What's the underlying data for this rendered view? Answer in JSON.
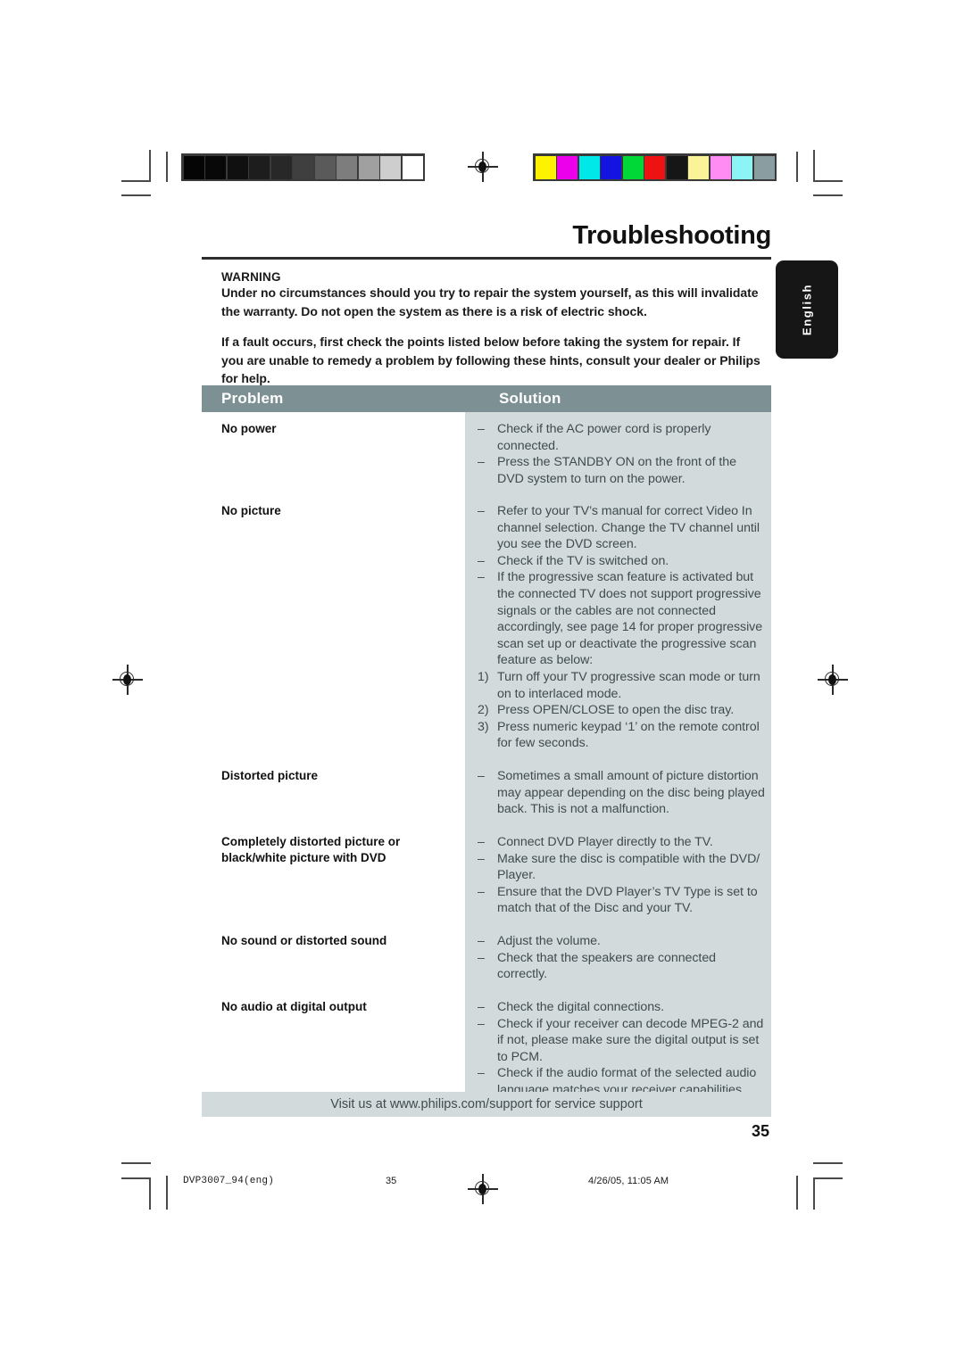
{
  "page": {
    "title": "Troubleshooting",
    "language_tab": "English",
    "page_number": "35"
  },
  "warning": {
    "heading": "WARNING",
    "paragraph1": "Under no circumstances should you try to repair the system yourself, as this will invalidate the warranty.  Do not open the system as there is a risk of electric shock.",
    "paragraph2": "If a fault occurs, first check the points listed below before taking the system for repair. If you are unable to remedy a problem by following these hints, consult your dealer or Philips for help."
  },
  "table": {
    "headers": {
      "problem": "Problem",
      "solution": "Solution"
    },
    "rows": [
      {
        "problem": "No power",
        "solutions": [
          {
            "marker": "–",
            "text": "Check if the AC power cord is properly connected."
          },
          {
            "marker": "–",
            "text": "Press the STANDBY ON on the front of the DVD system to turn on the power."
          }
        ]
      },
      {
        "problem": "No picture",
        "solutions": [
          {
            "marker": "–",
            "text": "Refer to your TV’s manual for correct Video In channel selection.  Change the TV channel until you see the DVD screen."
          },
          {
            "marker": "–",
            "text": "Check if the TV is switched on."
          },
          {
            "marker": "–",
            "text": "If the progressive scan feature is activated but the connected TV does not support progressive signals or the cables are not connected accordingly, see page 14 for proper progressive scan set up or deactivate the progressive scan feature as below:"
          },
          {
            "marker": "1)",
            "text": "Turn off your TV progressive scan mode or turn on to interlaced mode."
          },
          {
            "marker": "2)",
            "text": "Press OPEN/CLOSE to open the disc tray."
          },
          {
            "marker": "3)",
            "text": "Press numeric keypad ‘1’ on the remote control for few seconds."
          }
        ]
      },
      {
        "problem": "Distorted picture",
        "solutions": [
          {
            "marker": "–",
            "text": "Sometimes a small amount of picture distortion may appear depending on the disc being played back. This is not a malfunction."
          }
        ]
      },
      {
        "problem": "Completely distorted picture or black/white picture with DVD",
        "solutions": [
          {
            "marker": "–",
            "text": "Connect DVD Player directly to the TV."
          },
          {
            "marker": "–",
            "text": "Make sure the disc is compatible with the DVD/ Player."
          },
          {
            "marker": "–",
            "text": "Ensure that the DVD Player’s TV Type is set to match that of the Disc and your TV."
          }
        ]
      },
      {
        "problem": "No sound or distorted sound",
        "solutions": [
          {
            "marker": "–",
            "text": "Adjust the volume."
          },
          {
            "marker": "–",
            "text": "Check that the speakers are connected correctly."
          }
        ]
      },
      {
        "problem": "No audio at digital output",
        "solutions": [
          {
            "marker": "–",
            "text": "Check the digital connections."
          },
          {
            "marker": "–",
            "text": "Check if your receiver can decode MPEG-2 and if not, please make sure the digital output is set to PCM."
          },
          {
            "marker": "–",
            "text": "Check if the audio format of the selected audio language matches your receiver capabilities."
          }
        ]
      }
    ],
    "footer_note": "Visit us at www.philips.com/support for service support"
  },
  "print_footer": {
    "file": "DVP3007_94(eng)",
    "page": "35",
    "date": "4/26/05, 11:05 AM"
  },
  "calibration": {
    "grayscale": [
      "#050505",
      "#080808",
      "#101010",
      "#1d1d1d",
      "#282828",
      "#3f3f3f",
      "#5a5a5a",
      "#7d7d7d",
      "#a0a0a0",
      "#cecece",
      "#ffffff"
    ],
    "colors": [
      "#fff200",
      "#ec00ec",
      "#00e8e8",
      "#1414e0",
      "#00d837",
      "#ef1212",
      "#161616",
      "#fbf398",
      "#ff8cf2",
      "#8cf4f4",
      "#8a9da1"
    ]
  },
  "accent_colors": {
    "table_header_bg": "#7d9094",
    "solution_bg": "#d3dadc",
    "lang_tab_bg": "#161616"
  }
}
